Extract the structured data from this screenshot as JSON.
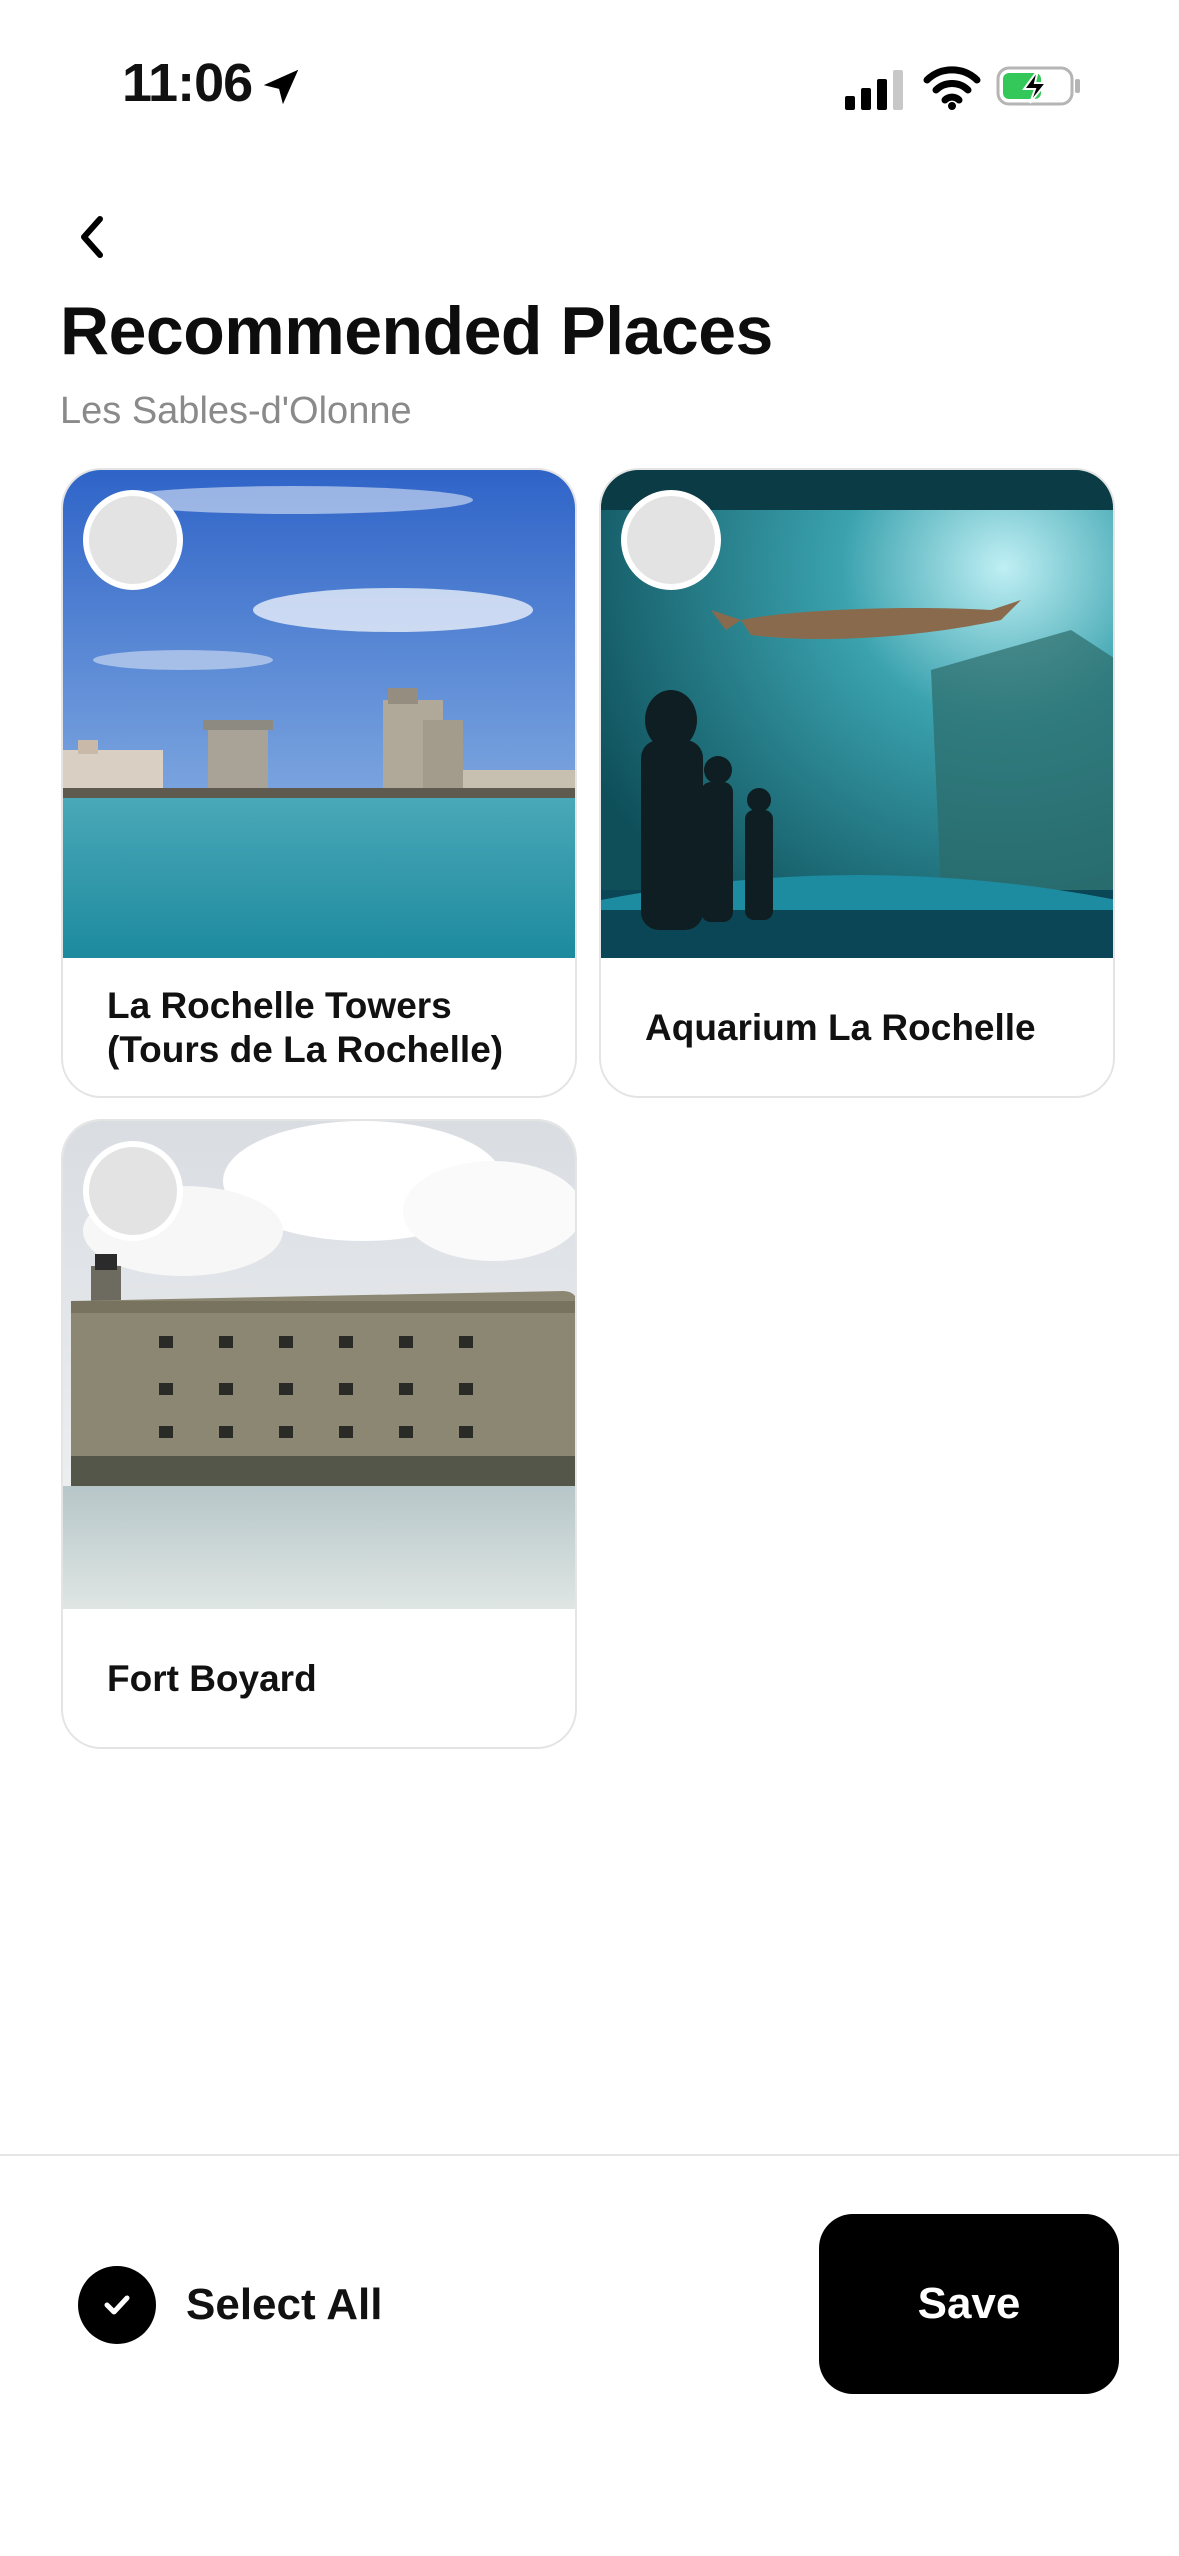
{
  "status_bar": {
    "time": "11:06",
    "icons": [
      "location-arrow-icon",
      "cellular-signal-icon",
      "wifi-icon",
      "battery-charging-icon"
    ],
    "battery_color": "#34c759"
  },
  "header": {
    "back_icon": "chevron-left-icon",
    "title": "Recommended Places",
    "subtitle": "Les Sables-d'Olonne"
  },
  "places": [
    {
      "name": "La Rochelle Towers (Tours de La Rochelle)",
      "selected": false
    },
    {
      "name": "Aquarium La Rochelle",
      "selected": false
    },
    {
      "name": "Fort Boyard",
      "selected": false
    }
  ],
  "footer": {
    "select_all_label": "Select All",
    "select_all_checked": true,
    "save_label": "Save"
  },
  "colors": {
    "primary": "#000000",
    "unselected_circle": "#e3e3e3",
    "subtitle": "#8a8a8a"
  }
}
